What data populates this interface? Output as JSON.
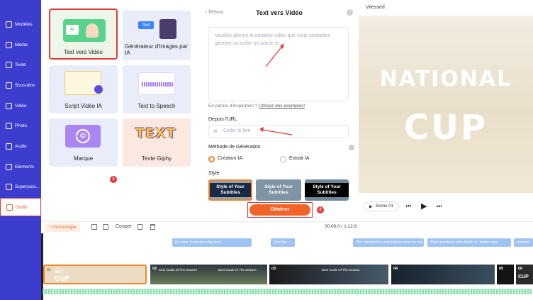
{
  "sidebar": {
    "items": [
      {
        "label": "Modèles",
        "icon": "templates-icon"
      },
      {
        "label": "Média",
        "icon": "media-icon"
      },
      {
        "label": "Texte",
        "icon": "text-icon"
      },
      {
        "label": "Sous-titre",
        "icon": "subtitle-icon"
      },
      {
        "label": "Vidéo",
        "icon": "video-icon"
      },
      {
        "label": "Photo",
        "icon": "photo-icon"
      },
      {
        "label": "Audio",
        "icon": "audio-icon"
      },
      {
        "label": "Eléments",
        "icon": "elements-icon"
      },
      {
        "label": "Superposi...",
        "icon": "overlay-icon"
      },
      {
        "label": "Outils",
        "icon": "tools-icon"
      }
    ]
  },
  "tools": {
    "cards": [
      {
        "label": "Text vers Vidéo"
      },
      {
        "label": "Générateur d'Images par IA"
      },
      {
        "label": "Script Vidéo IA"
      },
      {
        "label": "Text to Speech"
      },
      {
        "label": "Marque"
      },
      {
        "label": "Texte Giphy"
      }
    ],
    "card_thumbs": {
      "ai_text": "AI",
      "image_gen_tag": "Text",
      "giphy_text": "TEXT"
    },
    "marker": "1"
  },
  "form": {
    "back": "Retour",
    "title": "Text vers Vidéo",
    "placeholder": "Veuillez décrire le contenu vidéo que vous souhaitez générer ou coller un article ici",
    "inspiration": "En panne d'inspiration ?",
    "inspiration_link": "Utilisez des exemples!",
    "url_label": "Depuis l'URL",
    "url_placeholder": "Coller le lien",
    "method_label": "Méthode de Génération",
    "method_ai": "Création IA",
    "method_extract": "Extrait IA",
    "style_label": "Style",
    "styles": [
      "Style of Your Subtitles",
      "Style of Your Subtitles",
      "Style of Your Subtitles"
    ],
    "generate": "Générer",
    "marker": "2"
  },
  "preview": {
    "project": "Vitessed",
    "canvas_line1": "NATIONAL",
    "canvas_line2": "CUP",
    "scene": "Scène 01"
  },
  "timeline": {
    "chronologie": "Chronologie",
    "couper": "Couper",
    "time": "00:00.0 / 1:12.8",
    "chips": [
      "It's time to review day four.",
      "Roll the...",
      "We checked in with Raj on how he shi...",
      "iPad interface with Swift UI, better sup...",
      "restore"
    ],
    "clips": [
      "01",
      "02",
      "03",
      "04",
      "05",
      "06"
    ],
    "clip_text": [
      "Club Goals Of The Season",
      "Best Goals Of The Season",
      "Best Goals Of The Season",
      "CUP"
    ],
    "thumb_nat": "NAT",
    "thumb_cup": "CUP"
  },
  "colors": {
    "sidebar": "#3c3ccf",
    "accent": "#f0652a",
    "highlight": "#e03a3a"
  }
}
